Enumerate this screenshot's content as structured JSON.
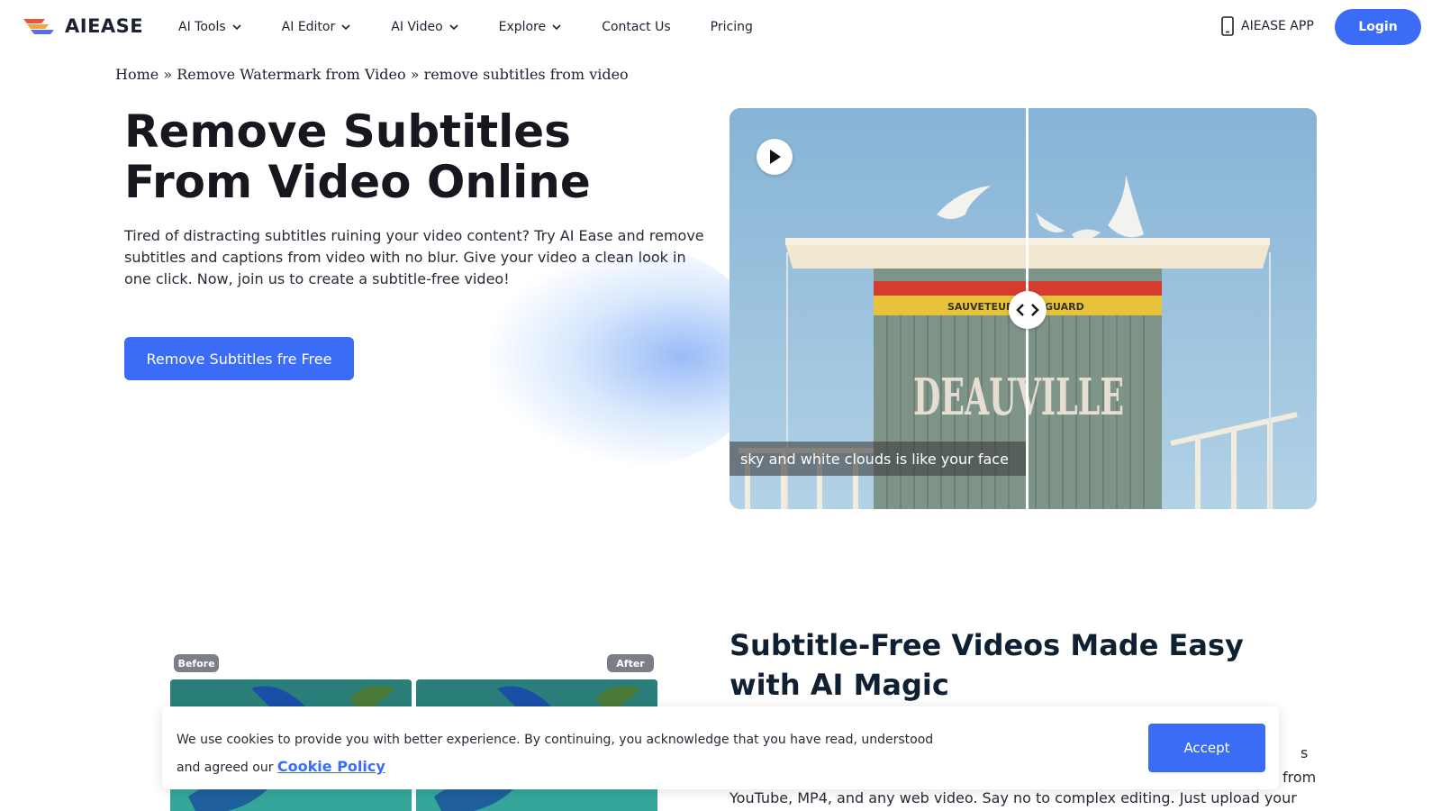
{
  "header": {
    "logo_text": "AIEASE",
    "nav": [
      {
        "label": "AI Tools",
        "has_dropdown": true
      },
      {
        "label": "AI Editor",
        "has_dropdown": true
      },
      {
        "label": "AI Video",
        "has_dropdown": true
      },
      {
        "label": "Explore",
        "has_dropdown": true
      },
      {
        "label": "Contact Us",
        "has_dropdown": false
      },
      {
        "label": "Pricing",
        "has_dropdown": false
      }
    ],
    "app_label": "AIEASE APP",
    "login_label": "Login"
  },
  "breadcrumb": {
    "home": "Home",
    "sep": "»",
    "parent": "Remove Watermark from Video",
    "current": "remove subtitles from video"
  },
  "hero": {
    "title": "Remove Subtitles From Video Online",
    "description": "Tired of distracting subtitles ruining your video content? Try AI Ease and remove subtitles and captions from video with no blur. Give your video a clean look in one click. Now, join us to create a subtitle-free video!",
    "cta_label": "Remove Subtitles fre Free",
    "media": {
      "subtitle_overlay": "sky and white clouds is like your face",
      "sign_band_text": "SAUVETEUR",
      "sign_band_text_right": "GUARD",
      "sign_big_text": "DEAUVILLE"
    }
  },
  "section2": {
    "title": "Subtitle-Free Videos Made Easy with AI Magic",
    "text_fragment_1": "s",
    "text_fragment_2": "from",
    "text_line": "YouTube, MP4, and any web video. Say no to complex editing. Just upload your",
    "before_label": "Before",
    "after_label": "After"
  },
  "cookie": {
    "text": "We use cookies to provide you with better experience. By continuing, you acknowledge that you have read, understood and agreed our",
    "link_label": "Cookie Policy",
    "accept_label": "Accept"
  },
  "colors": {
    "accent": "#3a6cf6",
    "title": "#17171f",
    "section_title": "#102033"
  }
}
